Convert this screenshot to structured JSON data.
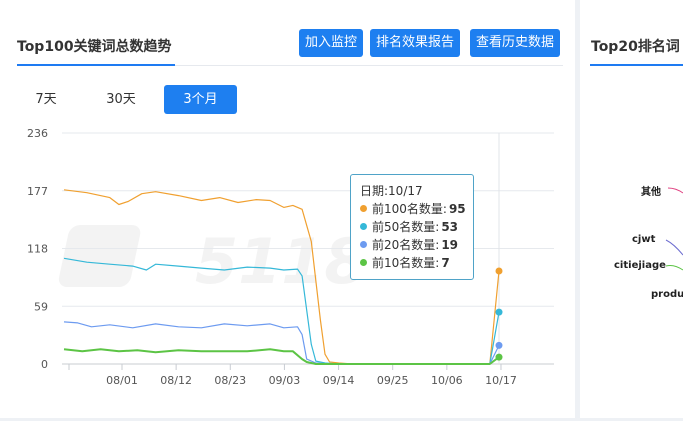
{
  "left_panel": {
    "title": "Top100关键词总数趋势",
    "buttons": [
      {
        "label": "加入监控"
      },
      {
        "label": "排名效果报告"
      },
      {
        "label": "查看历史数据"
      }
    ],
    "tabs": [
      {
        "label": "7天",
        "active": false
      },
      {
        "label": "30天",
        "active": false
      },
      {
        "label": "3个月",
        "active": true
      }
    ]
  },
  "tooltip": {
    "date_label": "日期:10/17",
    "rows": [
      {
        "label": "前100名数量:",
        "value": "95",
        "color": "#f0a030"
      },
      {
        "label": "前50名数量:",
        "value": "53",
        "color": "#35b8d8"
      },
      {
        "label": "前20名数量:",
        "value": "19",
        "color": "#6d9bf0"
      },
      {
        "label": "前10名数量:",
        "value": "7",
        "color": "#5cc445"
      }
    ]
  },
  "watermark": "5118",
  "right_panel": {
    "title": "Top20排名词",
    "legend": [
      {
        "label": "其他"
      },
      {
        "label": "cjwt"
      },
      {
        "label": "citiejiage"
      },
      {
        "label": "produ"
      }
    ]
  },
  "chart_data": {
    "type": "line",
    "x_ticks": [
      "08/01",
      "08/12",
      "08/23",
      "09/03",
      "09/14",
      "09/25",
      "10/06",
      "10/17"
    ],
    "y_ticks": [
      "0",
      "59",
      "118",
      "177",
      "236"
    ],
    "ylim": [
      0,
      236
    ],
    "grid": true,
    "x_range": [
      0,
      95
    ],
    "series": [
      {
        "name": "前100名数量",
        "color": "#f0a030",
        "points": [
          [
            0,
            178
          ],
          [
            5,
            175
          ],
          [
            10,
            170
          ],
          [
            12,
            163
          ],
          [
            14,
            166
          ],
          [
            17,
            174
          ],
          [
            20,
            176
          ],
          [
            25,
            172
          ],
          [
            30,
            167
          ],
          [
            34,
            170
          ],
          [
            38,
            165
          ],
          [
            42,
            168
          ],
          [
            45,
            167
          ],
          [
            48,
            160
          ],
          [
            50,
            162
          ],
          [
            52,
            158
          ],
          [
            54,
            125
          ],
          [
            56,
            45
          ],
          [
            57,
            10
          ],
          [
            58,
            2
          ],
          [
            60,
            1
          ],
          [
            63,
            0
          ],
          [
            70,
            0
          ],
          [
            80,
            0
          ],
          [
            90,
            0
          ],
          [
            93,
            0
          ],
          [
            95,
            95
          ]
        ]
      },
      {
        "name": "前50名数量",
        "color": "#35b8d8",
        "points": [
          [
            0,
            108
          ],
          [
            5,
            104
          ],
          [
            10,
            102
          ],
          [
            15,
            100
          ],
          [
            18,
            96
          ],
          [
            20,
            102
          ],
          [
            25,
            100
          ],
          [
            30,
            98
          ],
          [
            35,
            96
          ],
          [
            40,
            99
          ],
          [
            45,
            98
          ],
          [
            48,
            96
          ],
          [
            51,
            97
          ],
          [
            52,
            90
          ],
          [
            54,
            20
          ],
          [
            55,
            3
          ],
          [
            57,
            1
          ],
          [
            60,
            0
          ],
          [
            70,
            0
          ],
          [
            80,
            0
          ],
          [
            90,
            0
          ],
          [
            93,
            0
          ],
          [
            95,
            53
          ]
        ]
      },
      {
        "name": "前20名数量",
        "color": "#6d9bf0",
        "points": [
          [
            0,
            43
          ],
          [
            3,
            42
          ],
          [
            6,
            38
          ],
          [
            10,
            40
          ],
          [
            15,
            37
          ],
          [
            20,
            41
          ],
          [
            25,
            38
          ],
          [
            30,
            37
          ],
          [
            35,
            41
          ],
          [
            40,
            39
          ],
          [
            45,
            41
          ],
          [
            48,
            37
          ],
          [
            51,
            38
          ],
          [
            52,
            30
          ],
          [
            53,
            5
          ],
          [
            55,
            1
          ],
          [
            58,
            0
          ],
          [
            70,
            0
          ],
          [
            80,
            0
          ],
          [
            90,
            0
          ],
          [
            93,
            0
          ],
          [
            95,
            19
          ]
        ]
      },
      {
        "name": "前10名数量",
        "color": "#5cc445",
        "points": [
          [
            0,
            15
          ],
          [
            4,
            13
          ],
          [
            8,
            15
          ],
          [
            12,
            13
          ],
          [
            16,
            14
          ],
          [
            20,
            12
          ],
          [
            25,
            14
          ],
          [
            30,
            13
          ],
          [
            35,
            13
          ],
          [
            40,
            13
          ],
          [
            45,
            15
          ],
          [
            48,
            13
          ],
          [
            50,
            13
          ],
          [
            52,
            5
          ],
          [
            53,
            2
          ],
          [
            55,
            0
          ],
          [
            70,
            0
          ],
          [
            80,
            0
          ],
          [
            90,
            0
          ],
          [
            93,
            0
          ],
          [
            95,
            7
          ]
        ]
      }
    ]
  }
}
